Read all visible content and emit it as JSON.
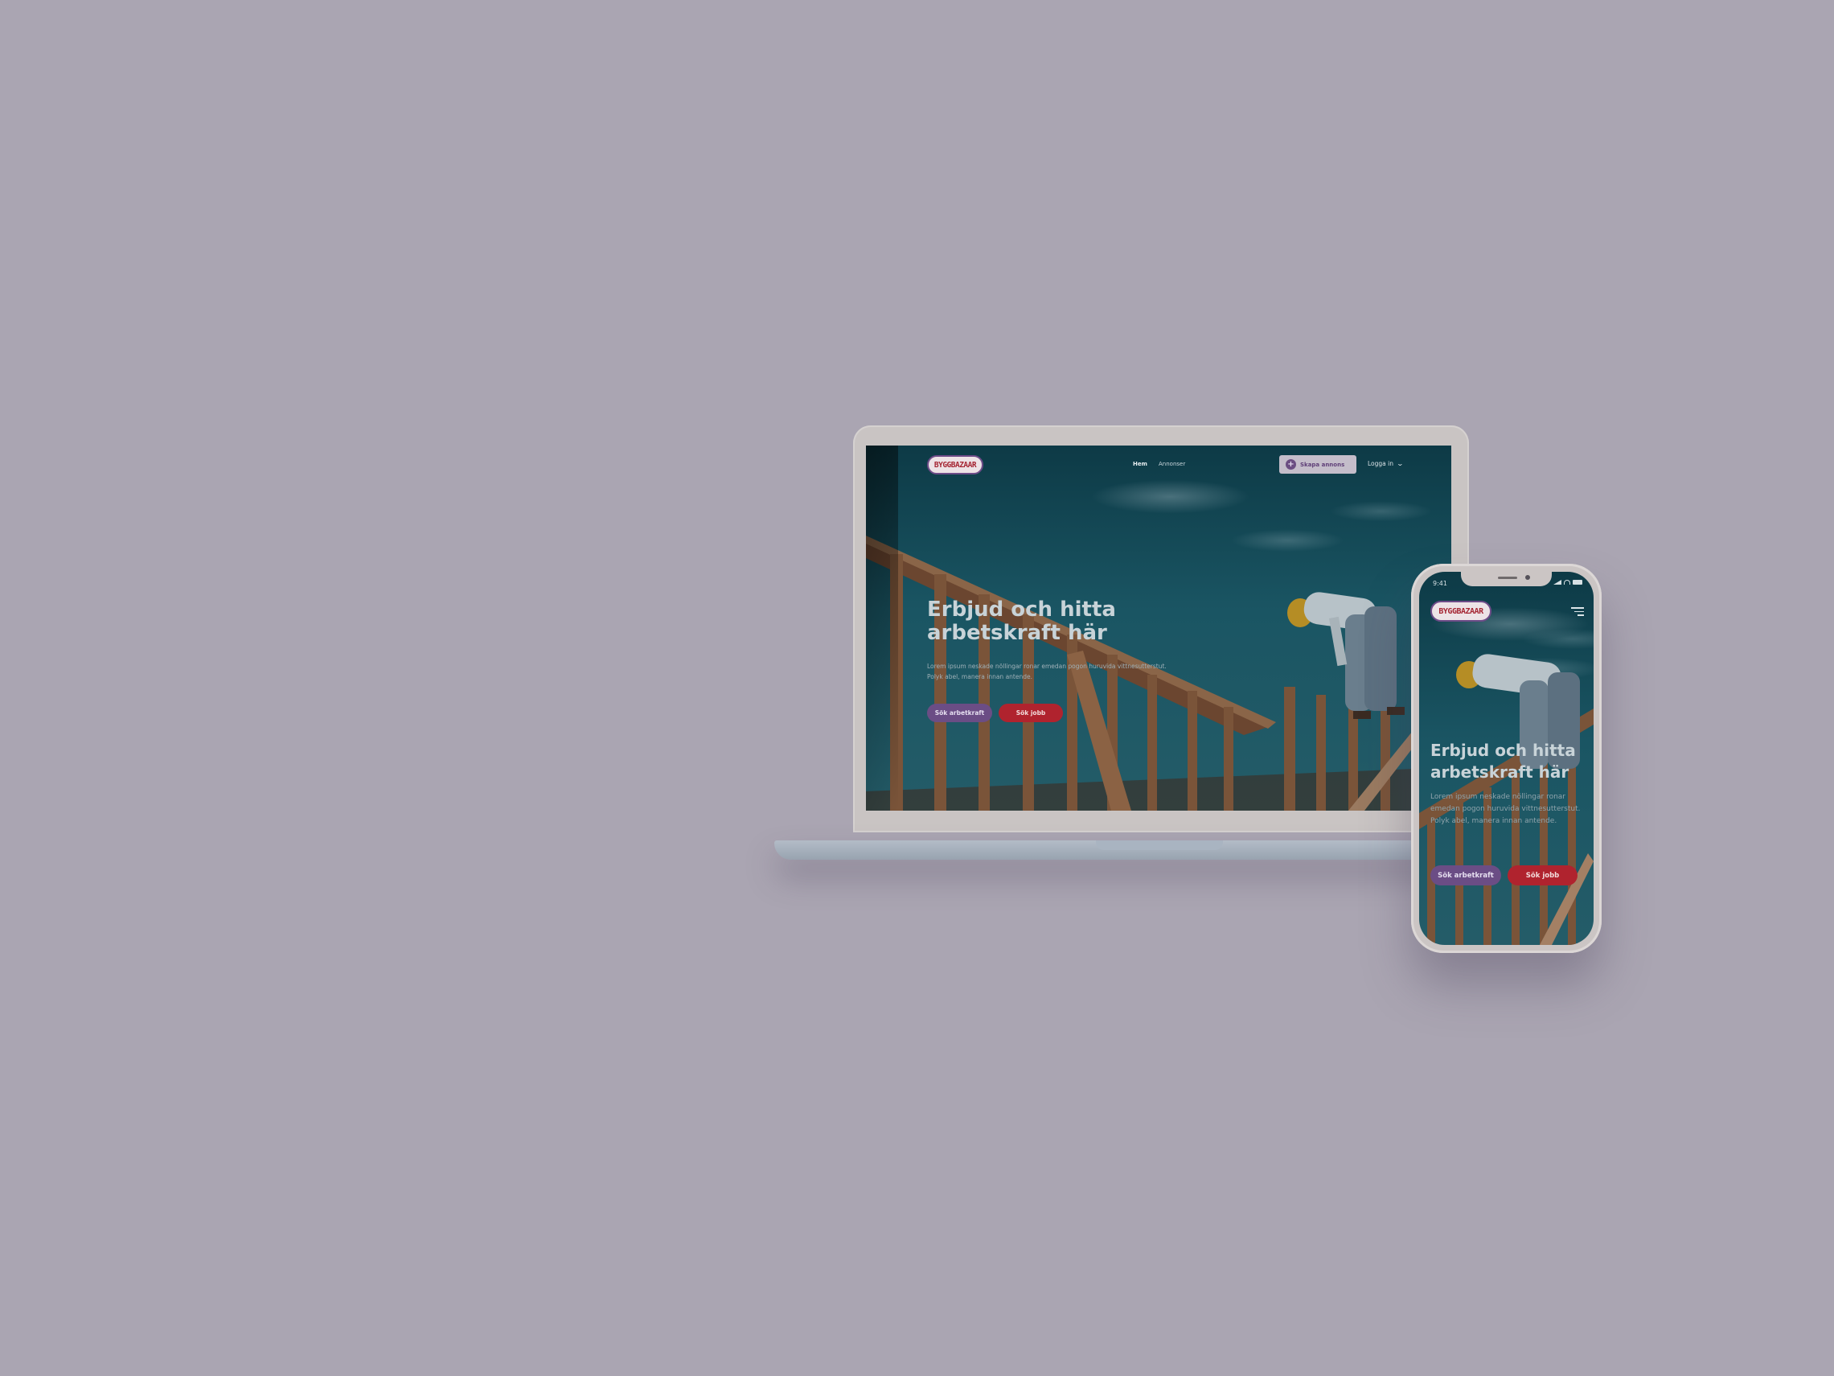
{
  "brand": {
    "logo_text": "BYGGBAZAAR",
    "accent_purple": "#6b4d85",
    "accent_red": "#b0232e"
  },
  "desktop": {
    "nav": {
      "links": [
        "Hem",
        "Annonser"
      ],
      "create_button": "Skapa annons",
      "login": "Logga in"
    },
    "hero": {
      "title": "Erbjud och hitta arbetskraft här",
      "body": "Lorem ipsum neskade nöllingar ronar emedan pogon huruvida vittnesutterstut. Polyk abel, manera innan antende.",
      "primary_button": "Sök arbetkraft",
      "secondary_button": "Sök jobb"
    }
  },
  "mobile": {
    "status_time": "9:41",
    "hero": {
      "title": "Erbjud och hitta arbetskraft här",
      "body": "Lorem ipsum neskade nöllingar ronar emedan pogon huruvida vittnesutterstut. Polyk abel, manera innan antende.",
      "primary_button": "Sök arbetkraft",
      "secondary_button": "Sök jobb"
    }
  }
}
